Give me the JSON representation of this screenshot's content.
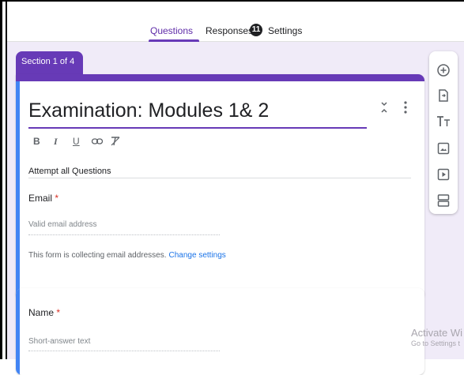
{
  "nav": {
    "tabs": [
      {
        "label": "Questions"
      },
      {
        "label": "Responses"
      },
      {
        "label": "Settings"
      }
    ],
    "responses_count": "11"
  },
  "section": {
    "label": "Section 1 of 4"
  },
  "form": {
    "title": "Examination: Modules 1& 2",
    "description": "Attempt all Questions",
    "format_buttons": [
      "B",
      "I",
      "U"
    ]
  },
  "questions": [
    {
      "label": "Email",
      "required_marker": "*",
      "placeholder": "Valid email address"
    },
    {
      "label": "Name",
      "required_marker": "*",
      "placeholder": "Short-answer text"
    }
  ],
  "collect_note": {
    "text": "This form is collecting email addresses.",
    "link": "Change settings"
  },
  "toolbar": {
    "icons": [
      "add-question-icon",
      "import-questions-icon",
      "add-title-icon",
      "add-image-icon",
      "add-video-icon",
      "add-section-icon"
    ]
  },
  "watermark": {
    "line1": "Activate Wi",
    "line2": "Go to Settings t"
  },
  "colors": {
    "accent": "#673ab7",
    "focus_bar": "#4285f4",
    "background": "#f0ebf8",
    "link": "#1a73e8",
    "required": "#d93025"
  }
}
